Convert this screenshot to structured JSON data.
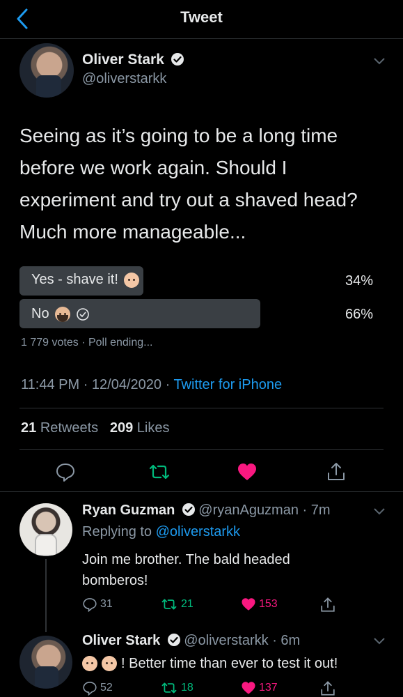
{
  "header": {
    "title": "Tweet"
  },
  "tweet": {
    "author_name": "Oliver Stark",
    "author_handle": "@oliverstarkk",
    "text": "Seeing as it’s going to be a long time before we work again. Should I experiment and try out a shaved head? Much more manageable...",
    "poll": {
      "options": [
        {
          "label": "Yes - shave it!",
          "percent": "34%",
          "fraction": 0.34
        },
        {
          "label": "No",
          "percent": "66%",
          "fraction": 0.66
        }
      ],
      "votes": "1 779 votes",
      "status": "Poll ending..."
    },
    "time": "11:44 PM",
    "date": "12/04/2020",
    "source": "Twitter for iPhone",
    "retweets_count": "21",
    "retweets_label": "Retweets",
    "likes_count": "209",
    "likes_label": "Likes"
  },
  "replies": [
    {
      "name": "Ryan Guzman",
      "handle": "@ryanAguzman",
      "age": "7m",
      "replying_prefix": "Replying to",
      "replying_to": "@oliverstarkk",
      "text_line1": "Join me brother. The bald headed",
      "text_line2": "bomberos!",
      "replies": "31",
      "retweets": "21",
      "likes": "153"
    },
    {
      "name": "Oliver Stark",
      "handle": "@oliverstarkk",
      "age": "6m",
      "text": "! Better time than ever to test it out!",
      "replies": "52",
      "retweets": "18",
      "likes": "137"
    }
  ],
  "colors": {
    "accent": "#1d9bf0",
    "like": "#f91880",
    "retweet": "#00ba7c",
    "muted": "#8b98a5"
  }
}
